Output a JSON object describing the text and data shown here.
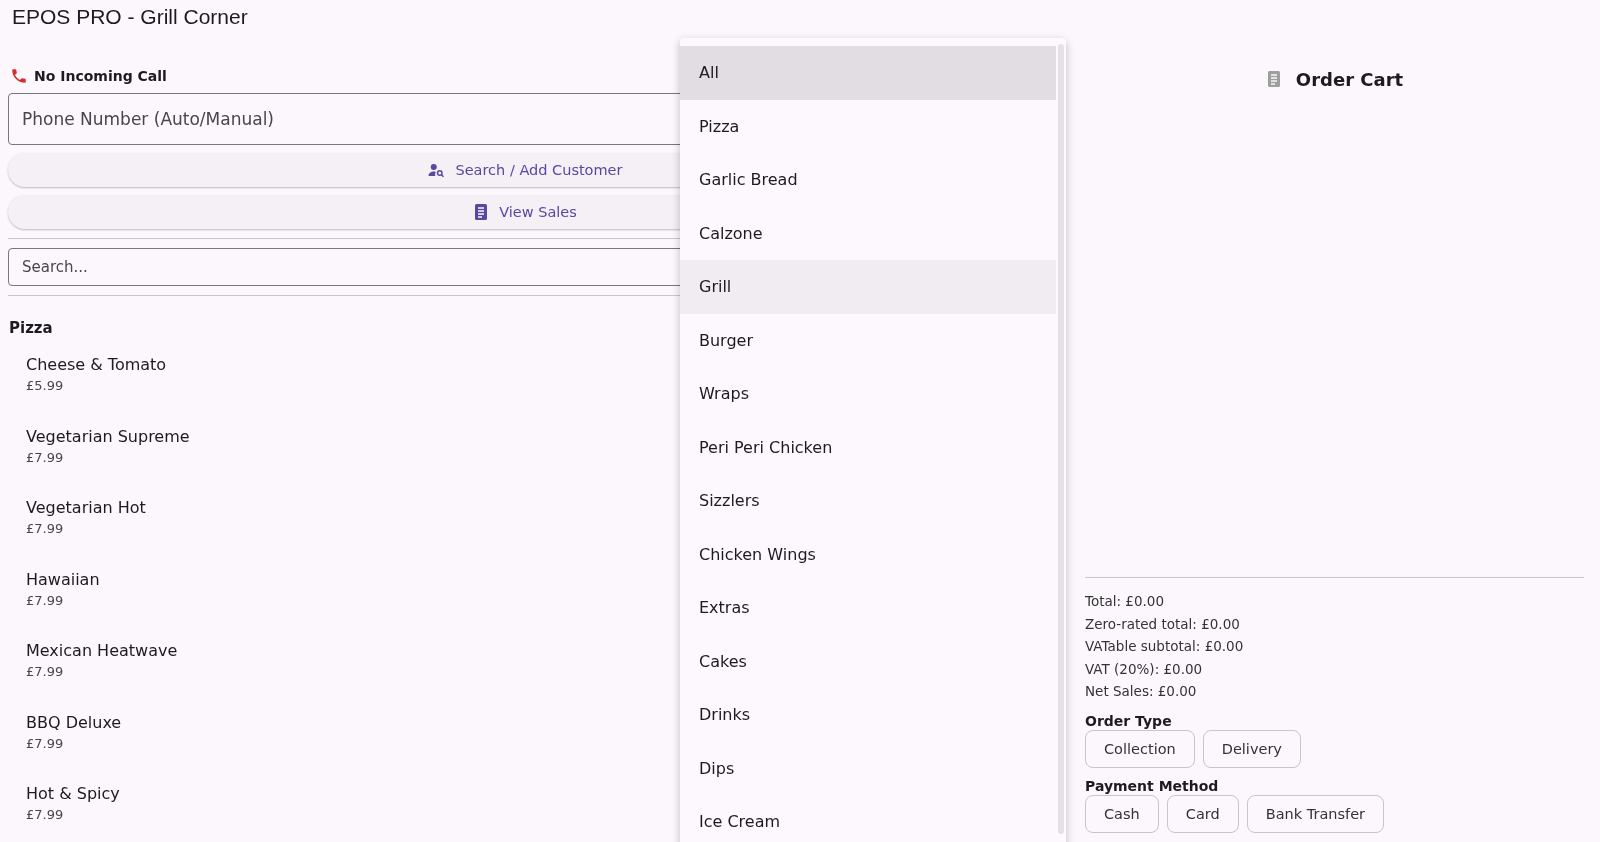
{
  "window": {
    "title": "EPOS PRO - Grill Corner"
  },
  "call_status": {
    "label": "No Incoming Call"
  },
  "phone_field": {
    "placeholder": "Phone Number (Auto/Manual)"
  },
  "buttons": [
    {
      "kind": "customer",
      "label": "Search / Add Customer"
    },
    {
      "kind": "sales",
      "label": "View Sales"
    }
  ],
  "search": {
    "placeholder": "Search..."
  },
  "menu": {
    "category": "Pizza",
    "items": [
      {
        "name": "Cheese & Tomato",
        "price": "£5.99"
      },
      {
        "name": "Vegetarian Supreme",
        "price": "£7.99"
      },
      {
        "name": "Vegetarian Hot",
        "price": "£7.99"
      },
      {
        "name": "Hawaiian",
        "price": "£7.99"
      },
      {
        "name": "Mexican Heatwave",
        "price": "£7.99"
      },
      {
        "name": "BBQ Deluxe",
        "price": "£7.99"
      },
      {
        "name": "Hot & Spicy",
        "price": "£7.99"
      }
    ]
  },
  "category_dropdown": {
    "options": [
      {
        "label": "All",
        "selected": true,
        "hovered": false
      },
      {
        "label": "Pizza",
        "selected": false,
        "hovered": false
      },
      {
        "label": "Garlic Bread",
        "selected": false,
        "hovered": false
      },
      {
        "label": "Calzone",
        "selected": false,
        "hovered": false
      },
      {
        "label": "Grill",
        "selected": false,
        "hovered": true
      },
      {
        "label": "Burger",
        "selected": false,
        "hovered": false
      },
      {
        "label": "Wraps",
        "selected": false,
        "hovered": false
      },
      {
        "label": "Peri Peri Chicken",
        "selected": false,
        "hovered": false
      },
      {
        "label": "Sizzlers",
        "selected": false,
        "hovered": false
      },
      {
        "label": "Chicken Wings",
        "selected": false,
        "hovered": false
      },
      {
        "label": "Extras",
        "selected": false,
        "hovered": false
      },
      {
        "label": "Cakes",
        "selected": false,
        "hovered": false
      },
      {
        "label": "Drinks",
        "selected": false,
        "hovered": false
      },
      {
        "label": "Dips",
        "selected": false,
        "hovered": false
      },
      {
        "label": "Ice Cream",
        "selected": false,
        "hovered": false
      }
    ]
  },
  "cart": {
    "title": "Order Cart",
    "totals": [
      "Total: £0.00",
      "Zero-rated total: £0.00",
      "VATable subtotal: £0.00",
      "VAT (20%): £0.00",
      "Net Sales: £0.00"
    ],
    "order_type": {
      "label": "Order Type",
      "options": [
        "Collection",
        "Delivery"
      ]
    },
    "payment_method": {
      "label": "Payment Method",
      "options": [
        "Cash",
        "Card",
        "Bank Transfer"
      ]
    }
  }
}
